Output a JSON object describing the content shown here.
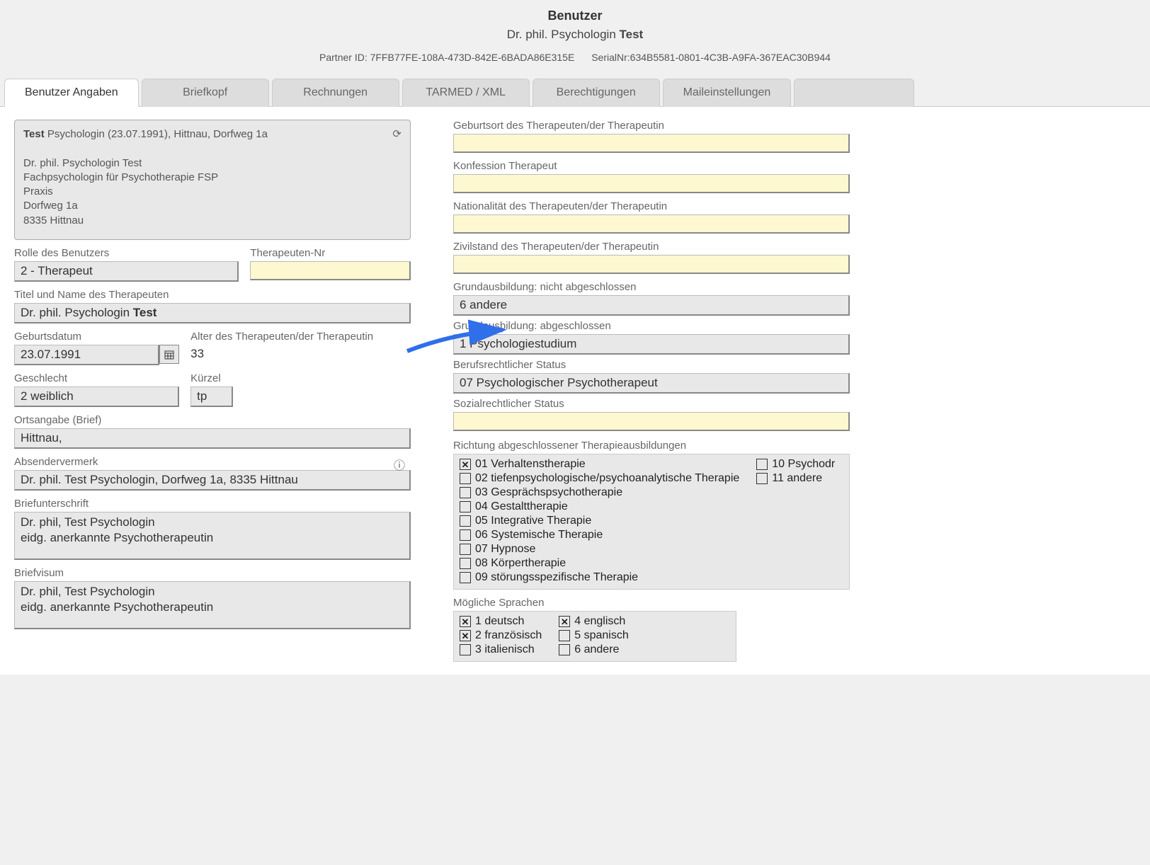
{
  "header": {
    "title": "Benutzer",
    "subtitle_prefix": "Dr. phil. Psychologin ",
    "subtitle_bold": "Test",
    "partner_id_label": "Partner ID: 7FFB77FE-108A-473D-842E-6BADA86E315E",
    "serial_label": "SerialNr:634B5581-0801-4C3B-A9FA-367EAC30B944"
  },
  "tabs": [
    "Benutzer Angaben",
    "Briefkopf",
    "Rechnungen",
    "TARMED / XML",
    "Berechtigungen",
    "Maileinstellungen"
  ],
  "summary": {
    "line1_bold": "Test",
    "line1_rest": " Psychologin (23.07.1991), Hittnau, Dorfweg 1a",
    "line3": "Dr. phil. Psychologin Test",
    "line4": "Fachpsychologin für Psychotherapie FSP",
    "line5": "Praxis",
    "line6": "Dorfweg 1a",
    "line7": "8335 Hittnau"
  },
  "left": {
    "rolle_label": "Rolle des Benutzers",
    "rolle_value": "2 - Therapeut",
    "therapeut_nr_label": "Therapeuten-Nr",
    "therapeut_nr_value": "",
    "titel_label": "Titel und Name des Therapeuten",
    "titel_value_prefix": "Dr. phil. Psychologin ",
    "titel_value_bold": "Test",
    "geburtsdatum_label": "Geburtsdatum",
    "geburtsdatum_value": "23.07.1991",
    "alter_label": "Alter des Therapeuten/der Therapeutin",
    "alter_value": "33",
    "geschlecht_label": "Geschlecht",
    "geschlecht_value": "2 weiblich",
    "kuerzel_label": "Kürzel",
    "kuerzel_value": "tp",
    "ortsangabe_label": "Ortsangabe (Brief)",
    "ortsangabe_value": "Hittnau,",
    "absender_label": "Absendervermerk",
    "absender_value": "Dr. phil. Test Psychologin, Dorfweg 1a, 8335 Hittnau",
    "unterschrift_label": "Briefunterschrift",
    "unterschrift_value": "Dr. phil, Test Psychologin\neidg. anerkannte Psychotherapeutin",
    "visum_label": "Briefvisum",
    "visum_value": "Dr. phil, Test Psychologin\neidg. anerkannte Psychotherapeutin"
  },
  "right": {
    "geburtsort_label": "Geburtsort des Therapeuten/der Therapeutin",
    "konfession_label": "Konfession Therapeut",
    "nationalitaet_label": "Nationalität des Therapeuten/der Therapeutin",
    "zivilstand_label": "Zivilstand des Therapeuten/der Therapeutin",
    "grund_nicht_label": "Grundausbildung: nicht abgeschlossen",
    "grund_nicht_value": "6 andere",
    "grund_ab_label": "Grundausbildung: abgeschlossen",
    "grund_ab_value": "1 Psychologiestudium",
    "berufsrecht_label": "Berufsrechtlicher Status",
    "berufsrecht_value": "07 Psychologischer Psychotherapeut",
    "sozialrecht_label": "Sozialrechtlicher Status",
    "richtung_label": "Richtung abgeschlossener Therapieausbildungen",
    "therapies_col1": [
      {
        "label": "01 Verhaltenstherapie",
        "checked": true
      },
      {
        "label": "02 tiefenpsychologische/psychoanalytische Therapie",
        "checked": false
      },
      {
        "label": "03 Gesprächspsychotherapie",
        "checked": false
      },
      {
        "label": "04 Gestalttherapie",
        "checked": false
      },
      {
        "label": "05 Integrative Therapie",
        "checked": false
      },
      {
        "label": "06 Systemische Therapie",
        "checked": false
      },
      {
        "label": "07 Hypnose",
        "checked": false
      },
      {
        "label": "08 Körpertherapie",
        "checked": false
      },
      {
        "label": "09 störungsspezifische Therapie",
        "checked": false
      }
    ],
    "therapies_col2": [
      {
        "label": "10 Psychodr",
        "checked": false
      },
      {
        "label": "11 andere",
        "checked": false
      }
    ],
    "sprachen_label": "Mögliche Sprachen",
    "sprachen_col1": [
      {
        "label": "1 deutsch",
        "checked": true
      },
      {
        "label": "2 französisch",
        "checked": true
      },
      {
        "label": "3 italienisch",
        "checked": false
      }
    ],
    "sprachen_col2": [
      {
        "label": "4 englisch",
        "checked": true
      },
      {
        "label": "5 spanisch",
        "checked": false
      },
      {
        "label": "6 andere",
        "checked": false
      }
    ]
  }
}
